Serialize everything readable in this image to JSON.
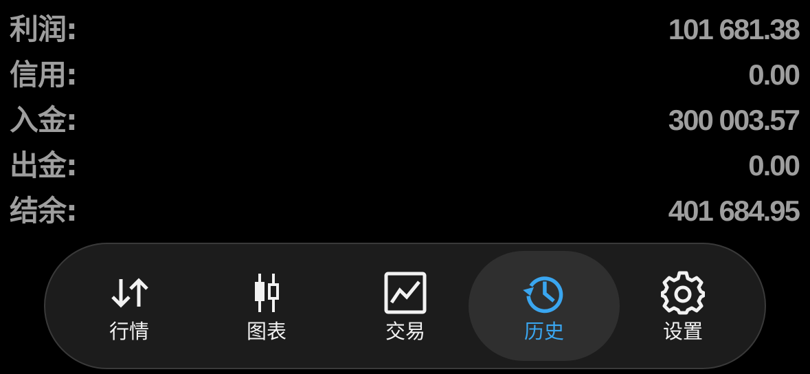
{
  "summary": {
    "rows": [
      {
        "label": "利润:",
        "value": "101 681.38"
      },
      {
        "label": "信用:",
        "value": "0.00"
      },
      {
        "label": "入金:",
        "value": "300 003.57"
      },
      {
        "label": "出金:",
        "value": "0.00"
      },
      {
        "label": "结余:",
        "value": "401 684.95"
      }
    ]
  },
  "tabs": [
    {
      "label": "行情",
      "icon": "arrows-up-down-icon",
      "active": false
    },
    {
      "label": "图表",
      "icon": "candlestick-icon",
      "active": false
    },
    {
      "label": "交易",
      "icon": "chart-line-icon",
      "active": false
    },
    {
      "label": "历史",
      "icon": "history-icon",
      "active": true
    },
    {
      "label": "设置",
      "icon": "gear-icon",
      "active": false
    }
  ],
  "colors": {
    "background": "#000000",
    "text": "#9e9e9e",
    "tab_text": "#f2f2f2",
    "accent": "#3aa6f0",
    "tabbar": "#1c1c1c"
  }
}
